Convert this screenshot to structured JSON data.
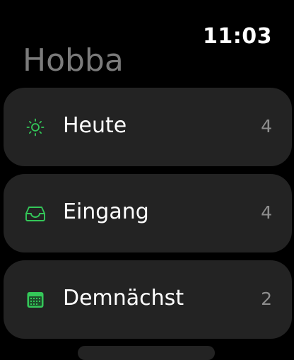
{
  "status_bar": {
    "time": "11:03"
  },
  "header": {
    "title": "Hobba"
  },
  "colors": {
    "accent": "#34c759",
    "card": "#232323",
    "title": "#7b7b7b",
    "count": "#8e8e8e"
  },
  "list": {
    "items": [
      {
        "label": "Heute",
        "count": "4",
        "icon": "sun-icon"
      },
      {
        "label": "Eingang",
        "count": "4",
        "icon": "inbox-tray-icon"
      },
      {
        "label": "Demnächst",
        "count": "2",
        "icon": "calendar-icon"
      }
    ]
  }
}
